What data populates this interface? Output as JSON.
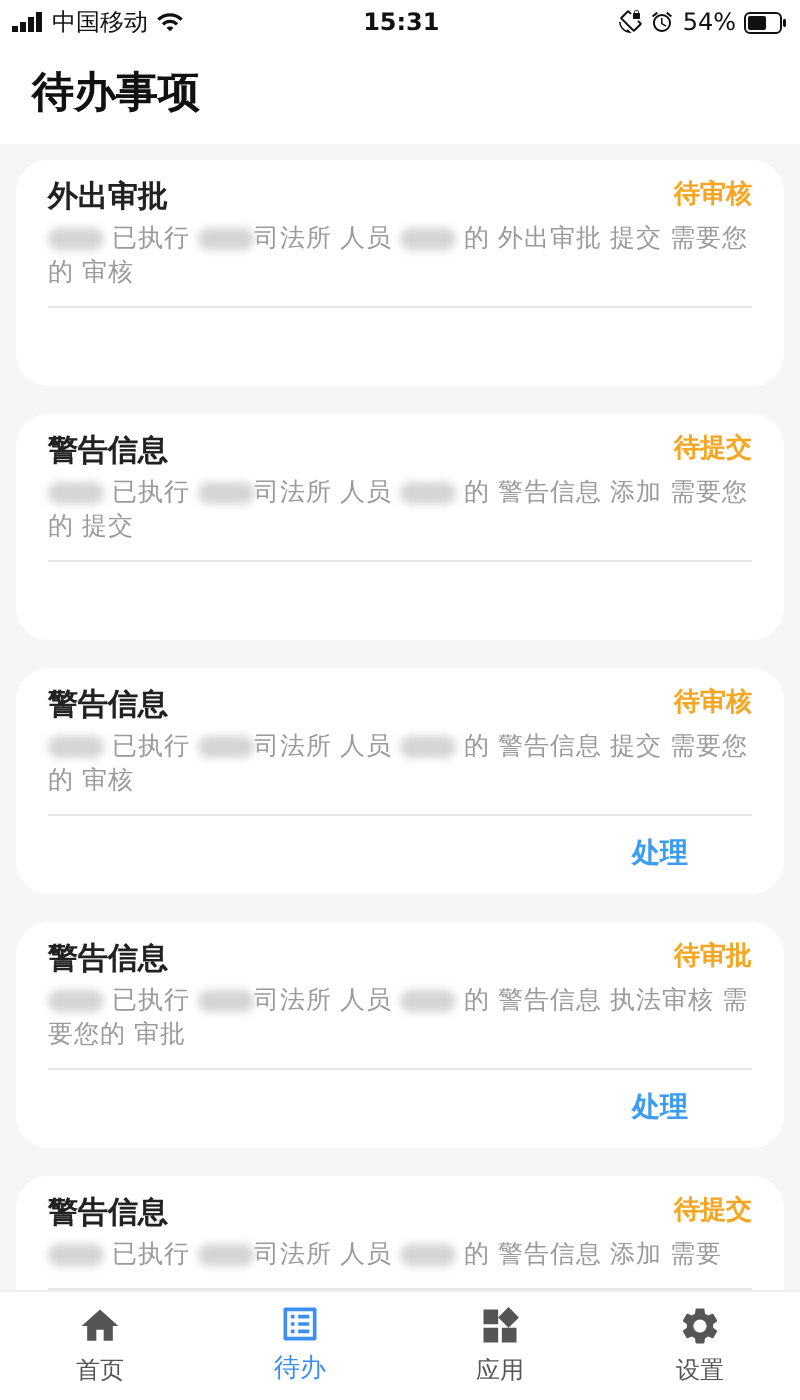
{
  "status_bar": {
    "carrier": "中国移动",
    "time": "15:31",
    "battery": "54%"
  },
  "header": {
    "title": "待办事项"
  },
  "tasks": [
    {
      "title": "外出审批",
      "status": "待审核",
      "message": [
        {
          "kind": "redacted"
        },
        {
          "kind": "text",
          "text": " 已执行 "
        },
        {
          "kind": "redacted"
        },
        {
          "kind": "text",
          "text": "司法所 人员 "
        },
        {
          "kind": "redacted"
        },
        {
          "kind": "text",
          "text": " 的 外出审批 提交 需要您的 审核"
        }
      ]
    },
    {
      "title": "警告信息",
      "status": "待提交",
      "message": [
        {
          "kind": "redacted"
        },
        {
          "kind": "text",
          "text": " 已执行 "
        },
        {
          "kind": "redacted"
        },
        {
          "kind": "text",
          "text": "司法所 人员 "
        },
        {
          "kind": "redacted"
        },
        {
          "kind": "text",
          "text": " 的 警告信息 添加 需要您的 提交"
        }
      ]
    },
    {
      "title": "警告信息",
      "status": "待审核",
      "action": "处理",
      "message": [
        {
          "kind": "redacted"
        },
        {
          "kind": "text",
          "text": " 已执行 "
        },
        {
          "kind": "redacted"
        },
        {
          "kind": "text",
          "text": "司法所 人员 "
        },
        {
          "kind": "redacted"
        },
        {
          "kind": "text",
          "text": " 的 警告信息 提交 需要您的 审核"
        }
      ]
    },
    {
      "title": "警告信息",
      "status": "待审批",
      "action": "处理",
      "message": [
        {
          "kind": "redacted"
        },
        {
          "kind": "text",
          "text": " 已执行 "
        },
        {
          "kind": "redacted"
        },
        {
          "kind": "text",
          "text": "司法所 人员 "
        },
        {
          "kind": "redacted"
        },
        {
          "kind": "text",
          "text": " 的 警告信息 执法审核 需要您的 审批"
        }
      ]
    },
    {
      "title": "警告信息",
      "status": "待提交",
      "message": [
        {
          "kind": "redacted"
        },
        {
          "kind": "text",
          "text": " 已执行 "
        },
        {
          "kind": "redacted"
        },
        {
          "kind": "text",
          "text": "司法所 人员 "
        },
        {
          "kind": "redacted"
        },
        {
          "kind": "text",
          "text": " 的 警告信息 添加 需要"
        }
      ]
    }
  ],
  "tab_bar": [
    {
      "label": "首页",
      "selected": false
    },
    {
      "label": "待办",
      "selected": true
    },
    {
      "label": "应用",
      "selected": false
    },
    {
      "label": "设置",
      "selected": false
    }
  ]
}
